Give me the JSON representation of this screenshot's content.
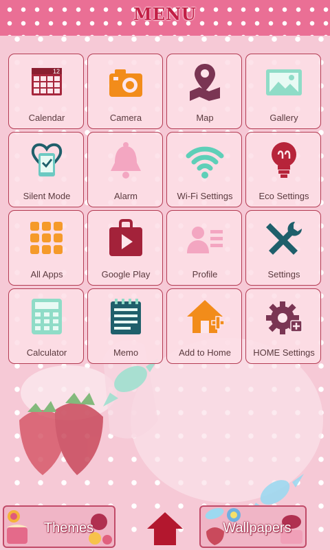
{
  "header": {
    "title": "MENU"
  },
  "tiles": [
    {
      "label": "Calendar",
      "icon": "calendar-icon",
      "badge": "12"
    },
    {
      "label": "Camera",
      "icon": "camera-icon"
    },
    {
      "label": "Map",
      "icon": "map-pin-icon"
    },
    {
      "label": "Gallery",
      "icon": "gallery-icon"
    },
    {
      "label": "Silent Mode",
      "icon": "silent-mode-icon"
    },
    {
      "label": "Alarm",
      "icon": "bell-icon"
    },
    {
      "label": "Wi-Fi Settings",
      "icon": "wifi-icon"
    },
    {
      "label": "Eco Settings",
      "icon": "lightbulb-icon"
    },
    {
      "label": "All Apps",
      "icon": "all-apps-grid-icon"
    },
    {
      "label": "Google Play",
      "icon": "play-bag-icon"
    },
    {
      "label": "Profile",
      "icon": "profile-icon"
    },
    {
      "label": "Settings",
      "icon": "wrench-screwdriver-icon"
    },
    {
      "label": "Calculator",
      "icon": "calculator-icon"
    },
    {
      "label": "Memo",
      "icon": "memo-icon"
    },
    {
      "label": "Add to Home",
      "icon": "add-to-home-icon"
    },
    {
      "label": "HOME Settings",
      "icon": "home-gear-icon"
    }
  ],
  "bottom": {
    "themes_label": "Themes",
    "wallpapers_label": "Wallpapers",
    "home_icon": "home-arrow-icon"
  },
  "colors": {
    "header": "#ea6f95",
    "background": "#f6c9d6",
    "tile_border": "#b33a52",
    "label_text": "#5a3a3e"
  }
}
